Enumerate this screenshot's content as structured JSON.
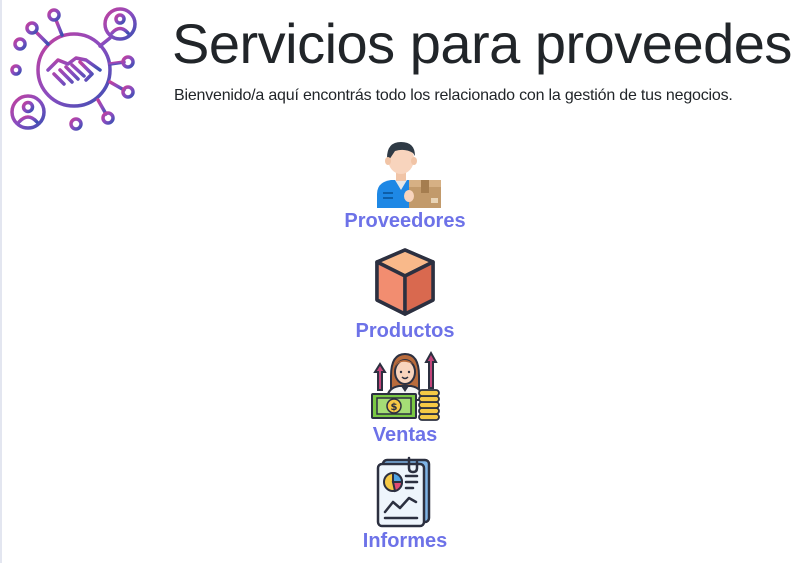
{
  "header": {
    "title": "Servicios para proveedes",
    "subtitle": "Bienvenido/a aquí encontrás todo los relacionado con la gestión de tus negocios."
  },
  "logo": {
    "icon": "handshake-network-icon",
    "colors": [
      "#b33fa0",
      "#7b4fc0",
      "#3f4fb0"
    ]
  },
  "menu": {
    "items": [
      {
        "label": "Proveedores",
        "icon": "supplier-icon"
      },
      {
        "label": "Productos",
        "icon": "product-box-icon"
      },
      {
        "label": "Ventas",
        "icon": "sales-icon"
      },
      {
        "label": "Informes",
        "icon": "report-icon"
      }
    ],
    "label_color": "#6d72e8"
  }
}
